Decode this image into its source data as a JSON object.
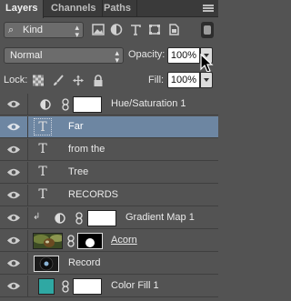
{
  "tabs": [
    {
      "label": "Layers",
      "active": true
    },
    {
      "label": "Channels",
      "active": false
    },
    {
      "label": "Paths",
      "active": false
    }
  ],
  "filter": {
    "kind_label": "Kind",
    "icons": [
      "image-filter-icon",
      "adjustment-filter-icon",
      "type-filter-icon",
      "shape-filter-icon",
      "smart-object-filter-icon"
    ]
  },
  "blend": {
    "mode": "Normal",
    "opacity_label": "Opacity:",
    "opacity_value": "100%"
  },
  "lock": {
    "label": "Lock:",
    "fill_label": "Fill:",
    "fill_value": "100%",
    "icons": [
      "lock-transparent-icon",
      "lock-brush-icon",
      "lock-move-icon",
      "lock-all-icon"
    ]
  },
  "layers": [
    {
      "name": "Hue/Saturation 1",
      "type": "adjustment",
      "selected": false
    },
    {
      "name": "Far",
      "type": "text",
      "selected": true
    },
    {
      "name": "from the",
      "type": "text",
      "selected": false
    },
    {
      "name": "Tree",
      "type": "text",
      "selected": false
    },
    {
      "name": "RECORDS",
      "type": "text",
      "selected": false
    },
    {
      "name": "Gradient Map 1",
      "type": "adjustment-clipped",
      "selected": false
    },
    {
      "name": "Acorn",
      "type": "image-mask",
      "selected": false
    },
    {
      "name": "Record",
      "type": "image",
      "selected": false
    },
    {
      "name": "Color Fill 1",
      "type": "fill",
      "selected": false
    }
  ],
  "colors": {
    "panel": "#535353",
    "selection": "#6d86a2",
    "fill_swatch": "#2fa8a3"
  }
}
